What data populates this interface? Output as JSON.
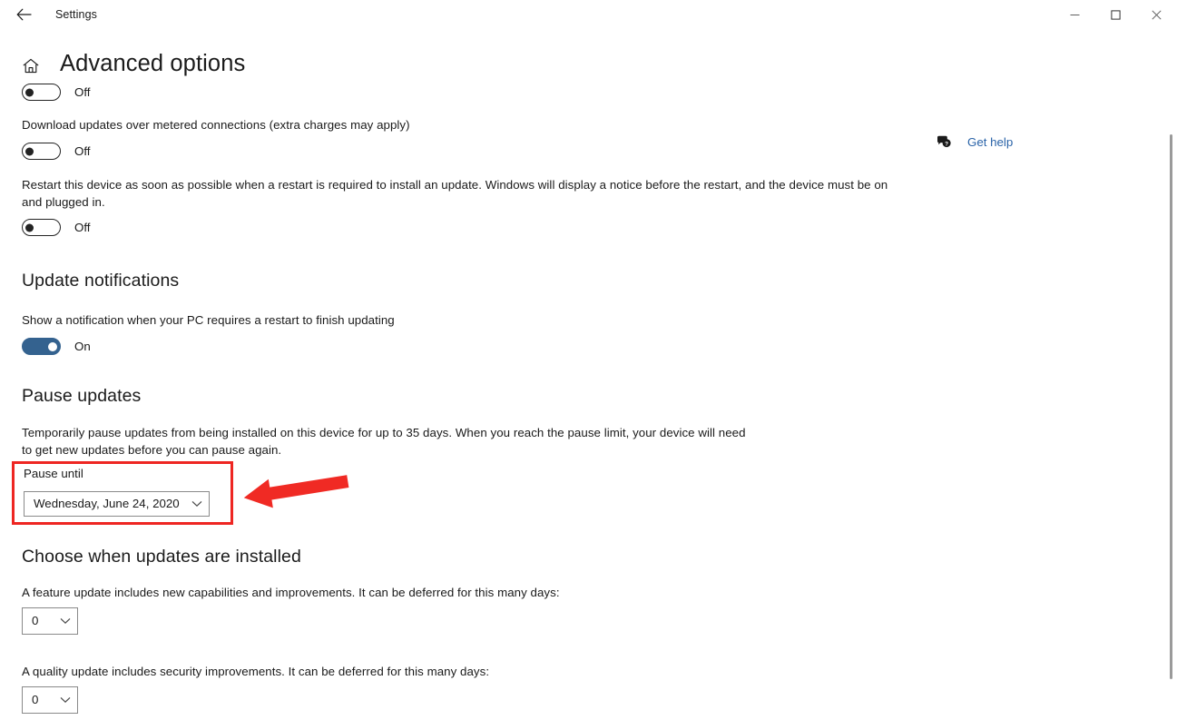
{
  "window": {
    "app_title": "Settings",
    "back_icon": "back-arrow-icon",
    "minimize_label": "—",
    "maximize_label": "□",
    "close_label": "✕"
  },
  "header": {
    "home_icon": "home-icon",
    "page_title": "Advanced options"
  },
  "help": {
    "icon": "help-chat-icon",
    "label": "Get help"
  },
  "settings": {
    "toggle_top": {
      "state_label": "Off",
      "on": false
    },
    "metered": {
      "description": "Download updates over metered connections (extra charges may apply)",
      "state_label": "Off",
      "on": false
    },
    "restart": {
      "description": "Restart this device as soon as possible when a restart is required to install an update. Windows will display a notice before the restart, and the device must be on and plugged in.",
      "state_label": "Off",
      "on": false
    }
  },
  "update_notifications": {
    "heading": "Update notifications",
    "description": "Show a notification when your PC requires a restart to finish updating",
    "state_label": "On",
    "on": true
  },
  "pause_updates": {
    "heading": "Pause updates",
    "description": "Temporarily pause updates from being installed on this device for up to 35 days. When you reach the pause limit, your device will need to get new updates before you can pause again.",
    "field_label": "Pause until",
    "selected_value": "Wednesday, June 24, 2020",
    "chevron_icon": "chevron-down-icon"
  },
  "choose_when": {
    "heading": "Choose when updates are installed",
    "feature_update": {
      "description": "A feature update includes new capabilities and improvements. It can be deferred for this many days:",
      "selected_value": "0",
      "chevron_icon": "chevron-down-icon"
    },
    "quality_update": {
      "description": "A quality update includes security improvements. It can be deferred for this many days:",
      "selected_value": "0",
      "chevron_icon": "chevron-down-icon"
    }
  },
  "annotation": {
    "color": "#ee2622",
    "box_target": "pause-until-field",
    "arrow_direction": "left"
  }
}
